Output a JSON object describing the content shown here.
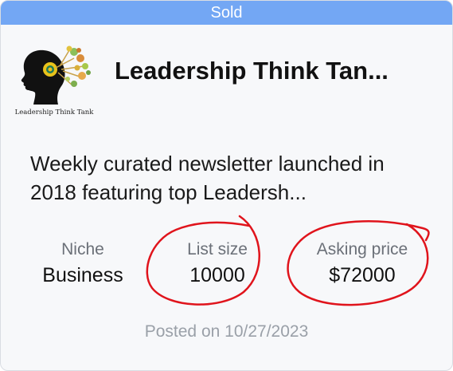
{
  "listing": {
    "status_banner": "Sold",
    "logo_caption": "Leadership Think Tank",
    "title": "Leadership Think Tan...",
    "description": "Weekly curated newsletter launched in 2018 featuring top Leadersh...",
    "stats": {
      "niche": {
        "label": "Niche",
        "value": "Business"
      },
      "list_size": {
        "label": "List size",
        "value": "10000"
      },
      "asking_price": {
        "label": "Asking price",
        "value": "$72000"
      }
    },
    "posted": "Posted on 10/27/2023"
  },
  "colors": {
    "banner": "#73a7f4",
    "annotation": "#e0141c",
    "card_background": "#f7f8fa"
  },
  "icons": [
    "leadership-head-logo-icon"
  ]
}
